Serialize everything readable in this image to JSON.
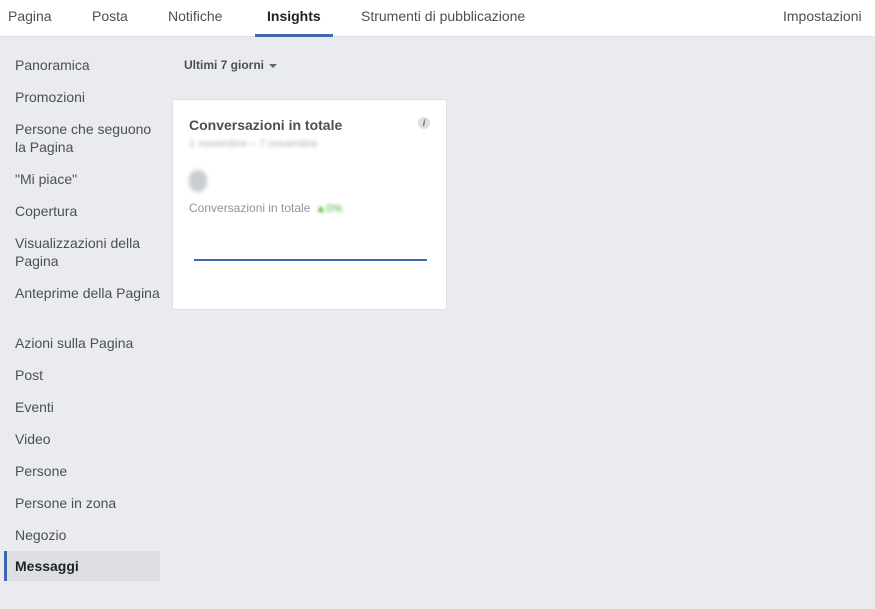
{
  "nav": {
    "tabs": [
      {
        "label": "Pagina"
      },
      {
        "label": "Posta"
      },
      {
        "label": "Notifiche"
      },
      {
        "label": "Insights"
      },
      {
        "label": "Strumenti di pubblicazione"
      }
    ],
    "active_tab": "Insights",
    "settings_label": "Impostazioni"
  },
  "sidebar": {
    "items": [
      {
        "label": "Panoramica"
      },
      {
        "label": "Promozioni"
      },
      {
        "label": "Persone che seguono la Pagina"
      },
      {
        "label": "\"Mi piace\""
      },
      {
        "label": "Copertura"
      },
      {
        "label": "Visualizzazioni della Pagina"
      },
      {
        "label": "Anteprime della Pagina"
      },
      {
        "label": "Azioni sulla Pagina"
      },
      {
        "label": "Post"
      },
      {
        "label": "Eventi"
      },
      {
        "label": "Video"
      },
      {
        "label": "Persone"
      },
      {
        "label": "Persone in zona"
      },
      {
        "label": "Negozio"
      },
      {
        "label": "Messaggi"
      }
    ],
    "selected": "Messaggi"
  },
  "main": {
    "date_range": "Ultimi 7 giorni",
    "card": {
      "title": "Conversazioni in totale",
      "date_range": "1 novembre – 7 novembre",
      "value": "0",
      "metric_label": "Conversazioni in totale",
      "change": "▲0%",
      "info_icon": "i"
    }
  },
  "colors": {
    "accent": "#4267b2",
    "background": "#e9ebee",
    "positive": "#42b72a"
  }
}
